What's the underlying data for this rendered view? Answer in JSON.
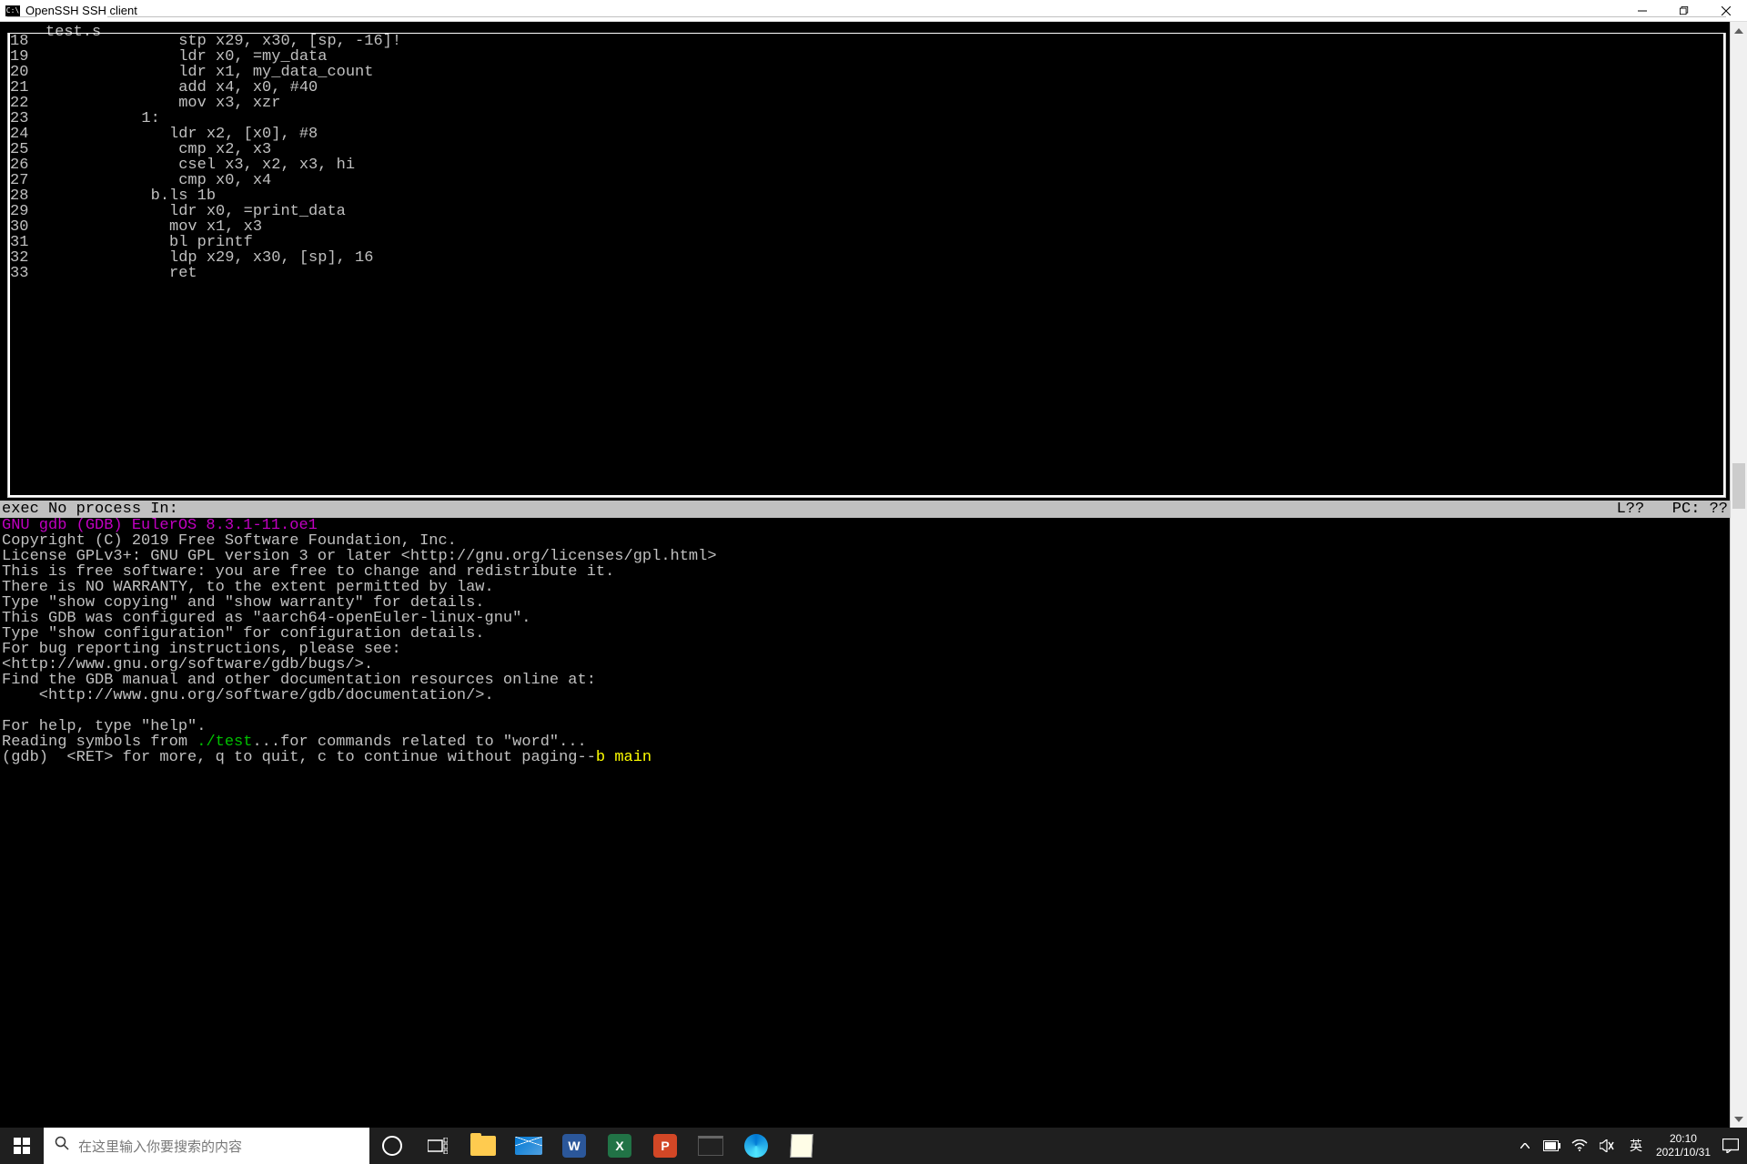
{
  "window": {
    "title": "OpenSSH SSH client",
    "icon_text": "C:\\"
  },
  "editor": {
    "filename": "test.s",
    "lines": [
      {
        "n": "18",
        "t": "                stp x29, x30, [sp, -16]!"
      },
      {
        "n": "19",
        "t": "                ldr x0, =my_data"
      },
      {
        "n": "20",
        "t": "                ldr x1, my_data_count"
      },
      {
        "n": "21",
        "t": "                add x4, x0, #40"
      },
      {
        "n": "22",
        "t": "                mov x3, xzr"
      },
      {
        "n": "23",
        "t": "            1:"
      },
      {
        "n": "24",
        "t": "               ldr x2, [x0], #8"
      },
      {
        "n": "25",
        "t": "                cmp x2, x3"
      },
      {
        "n": "26",
        "t": "                csel x3, x2, x3, hi"
      },
      {
        "n": "27",
        "t": "                cmp x0, x4"
      },
      {
        "n": "28",
        "t": "             b.ls 1b"
      },
      {
        "n": "29",
        "t": "               ldr x0, =print_data"
      },
      {
        "n": "30",
        "t": "               mov x1, x3"
      },
      {
        "n": "31",
        "t": "               bl printf"
      },
      {
        "n": "32",
        "t": "               ldp x29, x30, [sp], 16"
      },
      {
        "n": "33",
        "t": "               ret"
      }
    ]
  },
  "status": {
    "left": "exec No process In:",
    "right": "L??   PC: ??"
  },
  "gdb": {
    "header": "GNU gdb (GDB) EulerOS 8.3.1-11.oe1",
    "body1": "Copyright (C) 2019 Free Software Foundation, Inc.\nLicense GPLv3+: GNU GPL version 3 or later <http://gnu.org/licenses/gpl.html>\nThis is free software: you are free to change and redistribute it.\nThere is NO WARRANTY, to the extent permitted by law.\nType \"show copying\" and \"show warranty\" for details.\nThis GDB was configured as \"aarch64-openEuler-linux-gnu\".\nType \"show configuration\" for configuration details.\nFor bug reporting instructions, please see:\n<http://www.gnu.org/software/gdb/bugs/>.\nFind the GDB manual and other documentation resources online at:\n    <http://www.gnu.org/software/gdb/documentation/>.\n\nFor help, type \"help\".",
    "reading_prefix": "Reading symbols from ",
    "reading_path": "./test",
    "reading_suffix": "...for commands related to \"word\"...",
    "prompt": "(gdb) ",
    "prompt_msg": " <RET> for more, q to quit, c to continue without paging--",
    "prompt_cmd": "b main"
  },
  "taskbar": {
    "search_placeholder": "在这里输入你要搜索的内容",
    "ime": "英",
    "time": "20:10",
    "date": "2021/10/31"
  }
}
